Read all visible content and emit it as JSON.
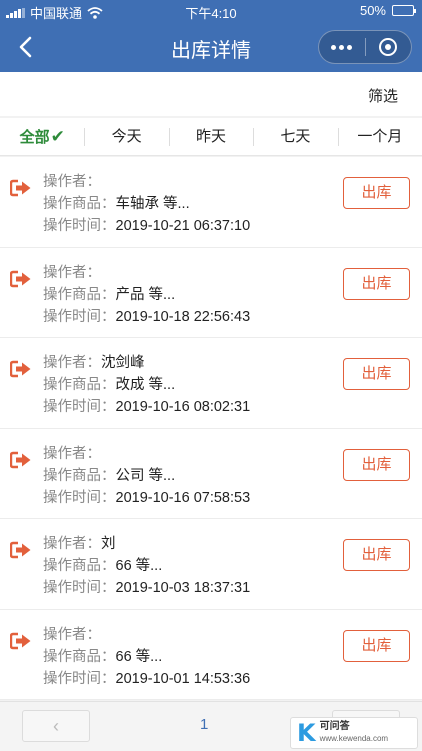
{
  "status_bar": {
    "carrier": "中国联通",
    "time": "下午4:10",
    "battery": "50%",
    "battery_level": 0.5
  },
  "nav": {
    "title": "出库详情"
  },
  "filter": {
    "label": "筛选"
  },
  "tabs": [
    {
      "label": "全部",
      "active": true
    },
    {
      "label": "今天"
    },
    {
      "label": "昨天"
    },
    {
      "label": "七天"
    },
    {
      "label": "一个月"
    }
  ],
  "labels": {
    "operator": "操作者：",
    "goods": "操作商品：",
    "time": "操作时间："
  },
  "records": [
    {
      "operator": "",
      "goods": "车轴承 等...",
      "time": "2019-10-21 06:37:10",
      "button": "出库"
    },
    {
      "operator": "",
      "goods": "产品 等...",
      "time": "2019-10-18 22:56:43",
      "button": "出库"
    },
    {
      "operator": "沈剑峰",
      "goods": "改成 等...",
      "time": "2019-10-16 08:02:31",
      "button": "出库"
    },
    {
      "operator": "",
      "goods": "公司 等...",
      "time": "2019-10-16 07:58:53",
      "button": "出库"
    },
    {
      "operator": "刘",
      "goods": "66 等...",
      "time": "2019-10-03 18:37:31",
      "button": "出库"
    },
    {
      "operator": "",
      "goods": "66 等...",
      "time": "2019-10-01 14:53:36",
      "button": "出库"
    }
  ],
  "pager": {
    "prev": "‹",
    "page": "1",
    "next": "›"
  },
  "watermark": {
    "logo_k": "K",
    "name": "可问答",
    "url": "www.kewenda.com"
  },
  "colors": {
    "primary": "#3f6fb4",
    "accent": "#e2603c",
    "active_tab": "#2e8b3a"
  }
}
